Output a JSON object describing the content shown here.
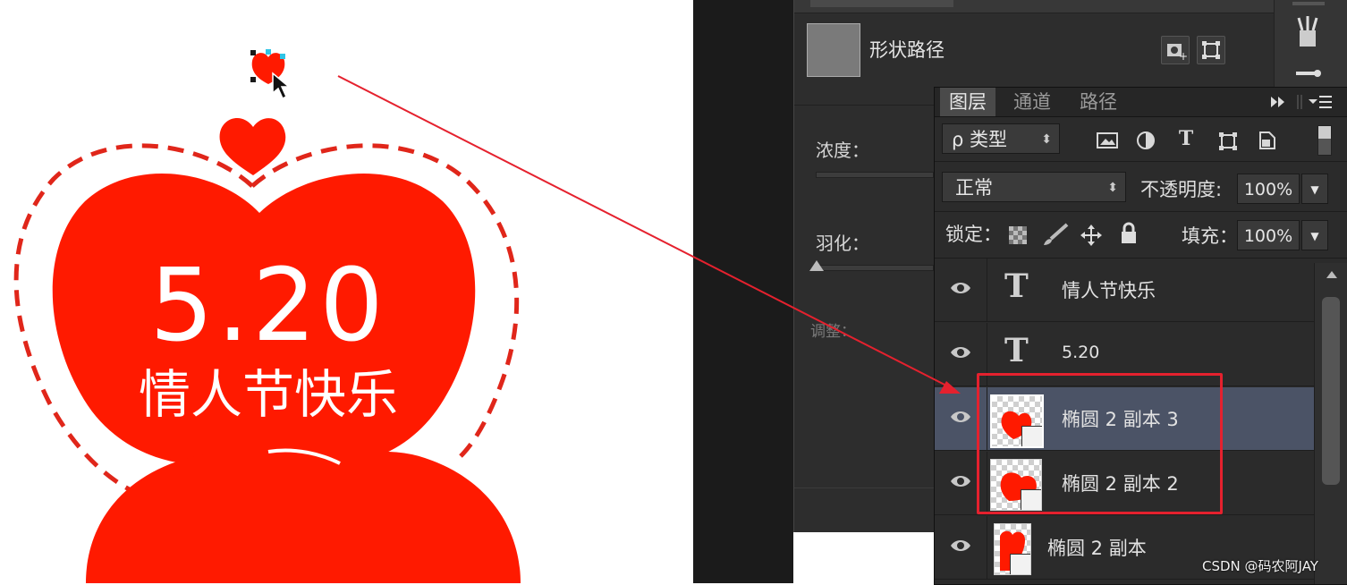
{
  "canvas": {
    "main_text": "5.20",
    "sub_text": "情人节快乐",
    "heart_color": "#ff1a00"
  },
  "properties_panel": {
    "shape_path_label": "形状路径",
    "density_label": "浓度：",
    "feather_label": "羽化：",
    "adjust_label": "调整："
  },
  "layers_panel": {
    "tabs": [
      "图层",
      "通道",
      "路径"
    ],
    "filter_kind": "ρ 类型",
    "blend_mode": "正常",
    "opacity_label": "不透明度:",
    "opacity_value": "100%",
    "lock_label": "锁定：",
    "fill_label": "填充：",
    "fill_value": "100%",
    "layers": [
      {
        "name": "情人节快乐",
        "type": "text",
        "selected": false
      },
      {
        "name": "5.20",
        "type": "text",
        "selected": false
      },
      {
        "name": "椭圆 2 副本 3",
        "type": "shape",
        "selected": true
      },
      {
        "name": "椭圆 2 副本 2",
        "type": "shape",
        "selected": false
      },
      {
        "name": "椭圆 2 副本",
        "type": "shape",
        "selected": false
      }
    ]
  },
  "watermark": "CSDN @码农阿JAY",
  "colors": {
    "annotation_red": "#e5212e",
    "selected_layer_bg": "#4b5366",
    "panel_bg": "#2b2b2b"
  }
}
